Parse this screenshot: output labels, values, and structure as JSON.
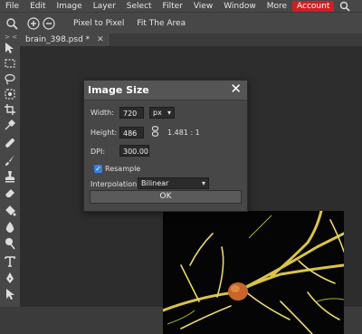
{
  "menubar": {
    "items": [
      "File",
      "Edit",
      "Image",
      "Layer",
      "Select",
      "Filter",
      "View",
      "Window",
      "More"
    ],
    "account_label": "Account",
    "account_color": "#cf1e25",
    "search_icon": "search-icon"
  },
  "optionsbar": {
    "tool_icon": "zoom-icon",
    "zoom_in_icon": "plus-circle-icon",
    "zoom_out_icon": "minus-circle-icon",
    "pixel_to_pixel_label": "Pixel to Pixel",
    "fit_area_label": "Fit The Area"
  },
  "tabs": [
    {
      "label": "brain_398.psd *",
      "close": "✕"
    }
  ],
  "toolbar": {
    "collapse_label": "> <",
    "tools": [
      "move",
      "marquee",
      "lasso",
      "quick-select",
      "crop",
      "eyedropper",
      "healing",
      "brush",
      "clone-stamp",
      "eraser",
      "paint-bucket",
      "blur",
      "dodge",
      "type",
      "pen",
      "path-select"
    ]
  },
  "dialog": {
    "title": "Image Size",
    "close": "✕",
    "width_label": "Width:",
    "width_value": "720",
    "unit_value": "px",
    "height_label": "Height:",
    "height_value": "486",
    "ratio_text": "1.481 : 1",
    "dpi_label": "DPI:",
    "dpi_value": "300.000",
    "resample_label": "Resample",
    "resample_checked": true,
    "interpolation_label": "Interpolation:",
    "interpolation_value": "Bilinear",
    "ok_label": "OK"
  },
  "colors": {
    "accent_blue": "#3a7fe0",
    "panel": "#474747",
    "workspace": "#2d2d2d"
  }
}
